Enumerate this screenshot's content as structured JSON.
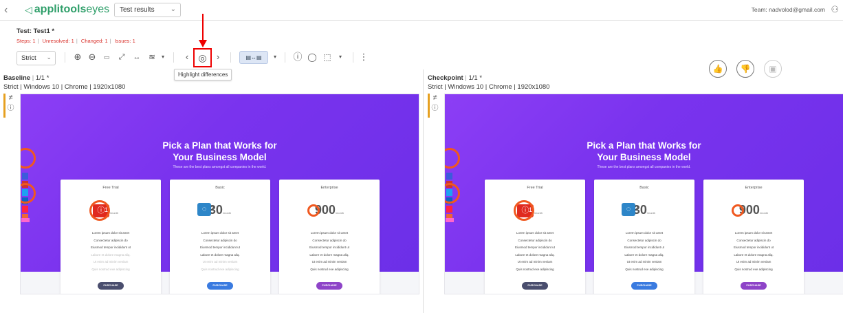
{
  "app": {
    "brand_bold": "applitools",
    "brand_light": "eyes"
  },
  "header": {
    "view_select": "Test results",
    "team": "Team: nadvolod@gmail.com"
  },
  "test": {
    "title": "Test: Test1 *",
    "stats": [
      "Steps: 1",
      "Unresolved: 1",
      "Changed: 1",
      "Issues: 1"
    ]
  },
  "toolbar": {
    "match_level": "Strict",
    "tooltip": "Highlight differences"
  },
  "baseline": {
    "title": "Baseline",
    "count": "1/1",
    "star": "*",
    "env": "Strict | Windows 10 | Chrome | 1920x1080"
  },
  "checkpoint": {
    "title": "Checkpoint",
    "count": "1/1",
    "star": "*",
    "env": "Strict | Windows 10 | Chrome | 1920x1080"
  },
  "page": {
    "headline_1": "Pick a Plan that Works for",
    "headline_2": "Your Business Model",
    "tagline": "These are the best plans amongst all companies in the world.",
    "plans": [
      {
        "name": "Free Trial",
        "price": "0",
        "per": "/month",
        "button": "PURCHASE",
        "color": "#4a4e6e"
      },
      {
        "name": "Basic",
        "price": "30",
        "per": "/month",
        "button": "PURCHASE",
        "color": "#3a7be0"
      },
      {
        "name": "Enterprise",
        "price": "900",
        "per": "/month",
        "button": "PURCHASE",
        "color": "#8e44c8"
      }
    ],
    "features": [
      "Lorem ipsum dolor sit amet",
      "Consectetur adipiscin do",
      "Eiusmod tempor incididunt ut",
      "Labore et dolore magna aliq.",
      "Ut enim ad minim veniam",
      "Quis nostrud exe adipiscing"
    ],
    "badge_issue": "1",
    "badge_remark": "2"
  }
}
